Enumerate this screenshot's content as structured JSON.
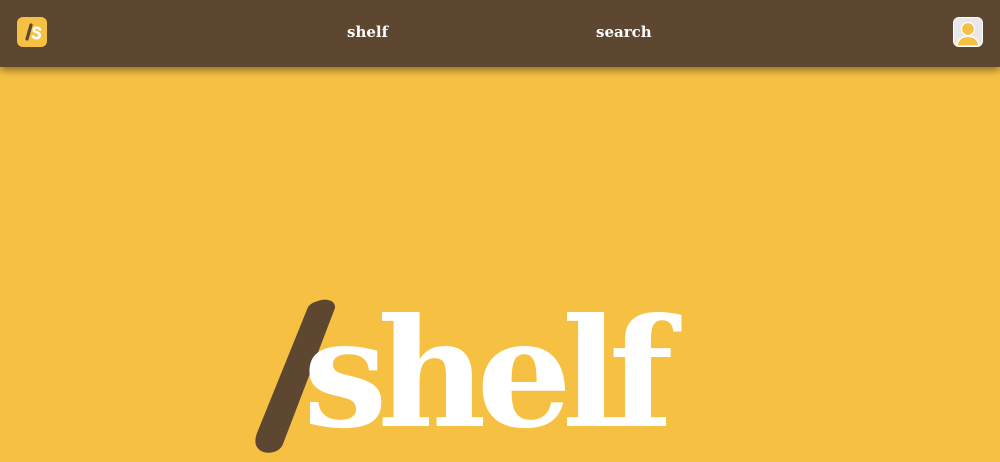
{
  "colors": {
    "brand_yellow": "#F6C143",
    "brand_brown": "#5E4730",
    "text_white": "#FFFFFF"
  },
  "navbar": {
    "logo": {
      "icon": "slash-s-logo-icon",
      "text": "/s"
    },
    "links": [
      {
        "label": "shelf"
      },
      {
        "label": "search"
      }
    ],
    "avatar": {
      "icon": "user-avatar-icon"
    }
  },
  "hero": {
    "slash": "/",
    "word": "shelf"
  }
}
